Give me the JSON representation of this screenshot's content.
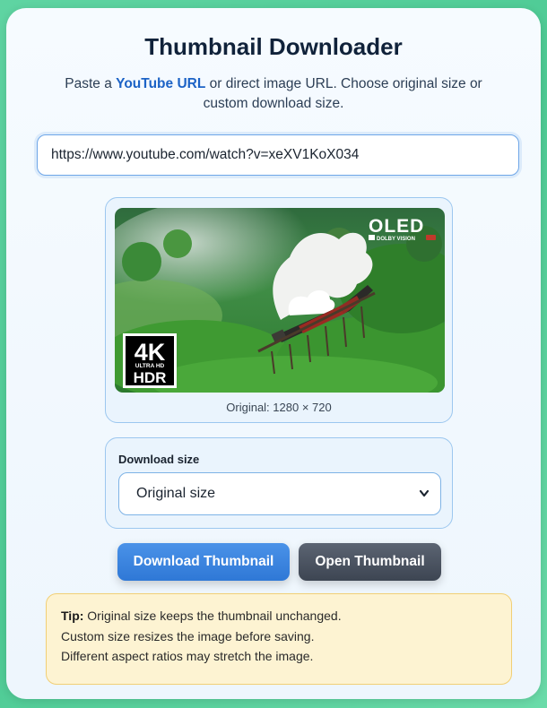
{
  "page": {
    "title": "Thumbnail Downloader",
    "subtitle_prefix": "Paste a ",
    "subtitle_link": "YouTube URL",
    "subtitle_suffix": " or direct image URL. Choose original size or custom download size."
  },
  "url_input": {
    "value": "https://www.youtube.com/watch?v=xeXV1KoX034"
  },
  "preview": {
    "badge_oled": "OLED",
    "badge_dolby": "DOLBY VISION",
    "badge_4k": "4K",
    "badge_ultra": "ULTRA HD",
    "badge_hdr": "HDR",
    "original_label": "Original: 1280 × 720"
  },
  "download_size": {
    "label": "Download size",
    "selected": "Original size",
    "chevron_icon": "chevron-down-icon"
  },
  "buttons": {
    "download": "Download Thumbnail",
    "open": "Open Thumbnail"
  },
  "tip": {
    "label": "Tip:",
    "line1": " Original size keeps the thumbnail unchanged.",
    "line2": "Custom size resizes the image before saving.",
    "line3": "Different aspect ratios may stretch the image."
  },
  "colors": {
    "background": "#4ecb95",
    "accent": "#2f78d6",
    "link": "#1d63c6",
    "tip_background": "#fdf3d2"
  }
}
